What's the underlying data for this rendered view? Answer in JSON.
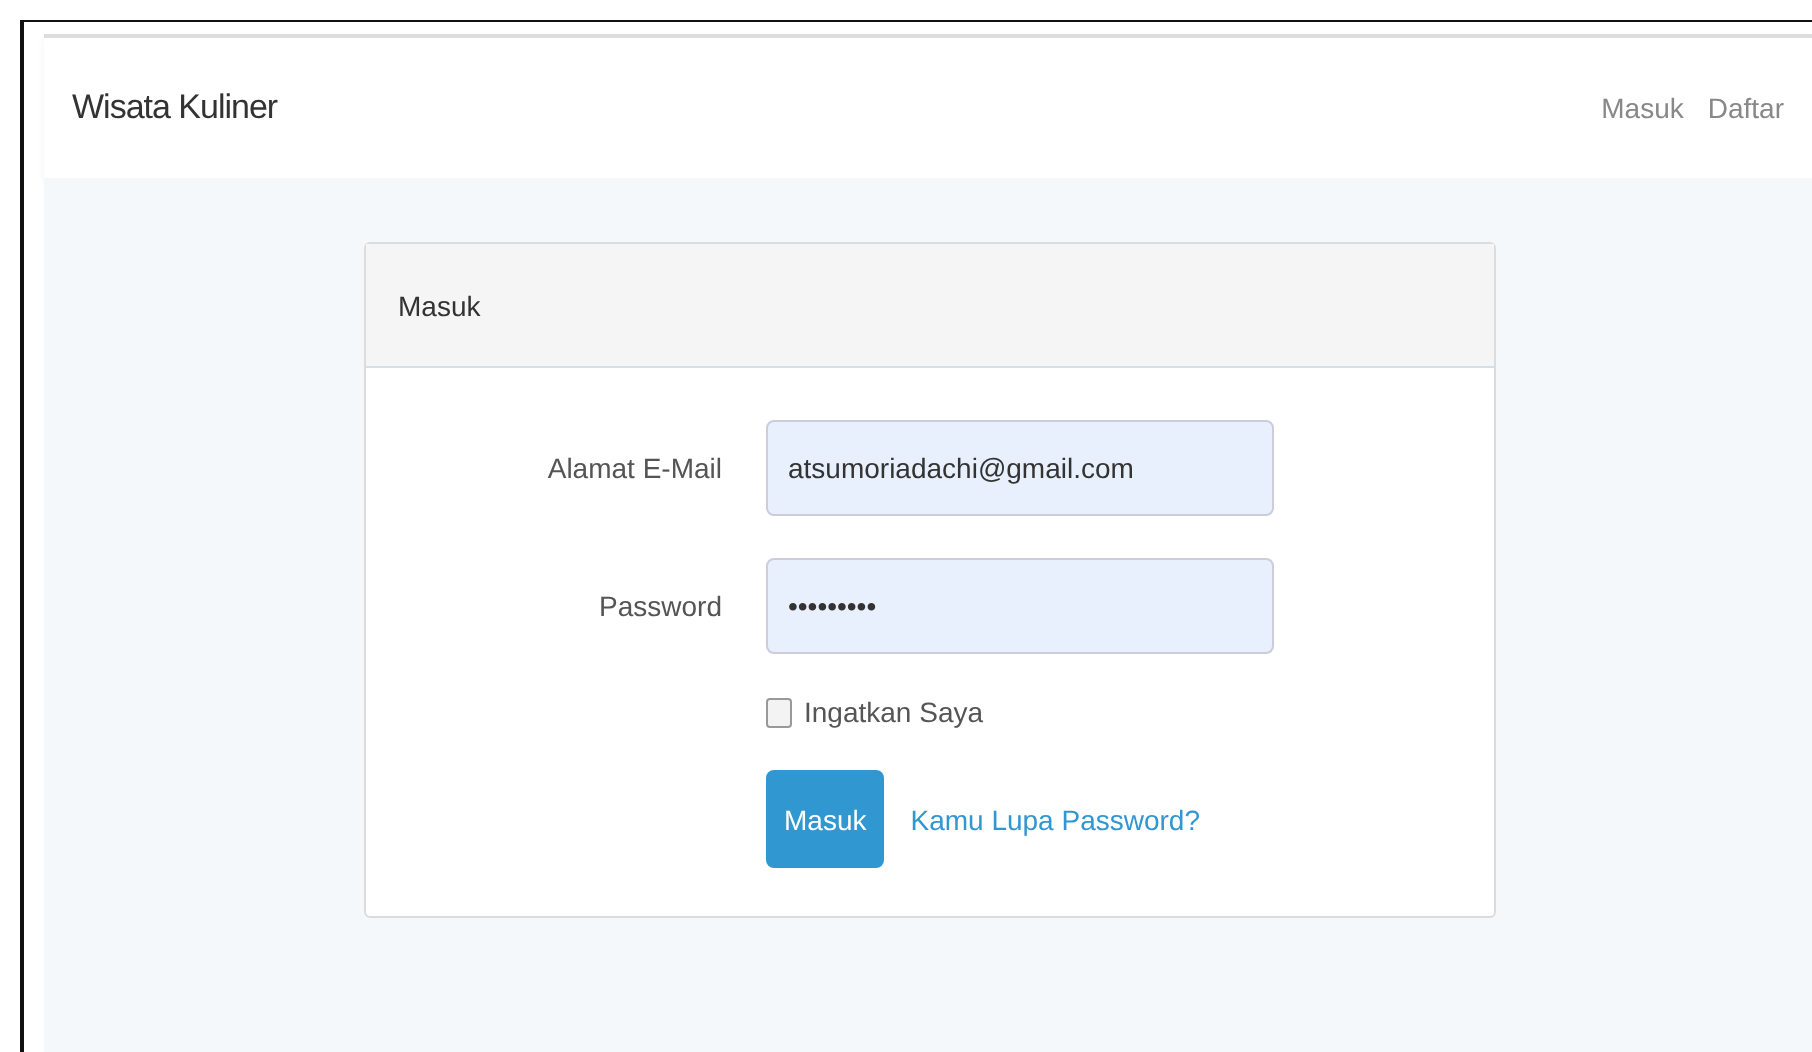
{
  "navbar": {
    "brand": "Wisata Kuliner",
    "links": [
      {
        "label": "Masuk"
      },
      {
        "label": "Daftar"
      }
    ]
  },
  "card": {
    "title": "Masuk",
    "fields": [
      {
        "label": "Alamat E-Mail",
        "value": "atsumoriadachi@gmail.com"
      },
      {
        "label": "Password",
        "value": "•••••••••"
      }
    ],
    "remember": {
      "label": "Ingatkan Saya",
      "checked": false
    },
    "submit": "Masuk",
    "forgot": "Kamu Lupa Password?"
  }
}
